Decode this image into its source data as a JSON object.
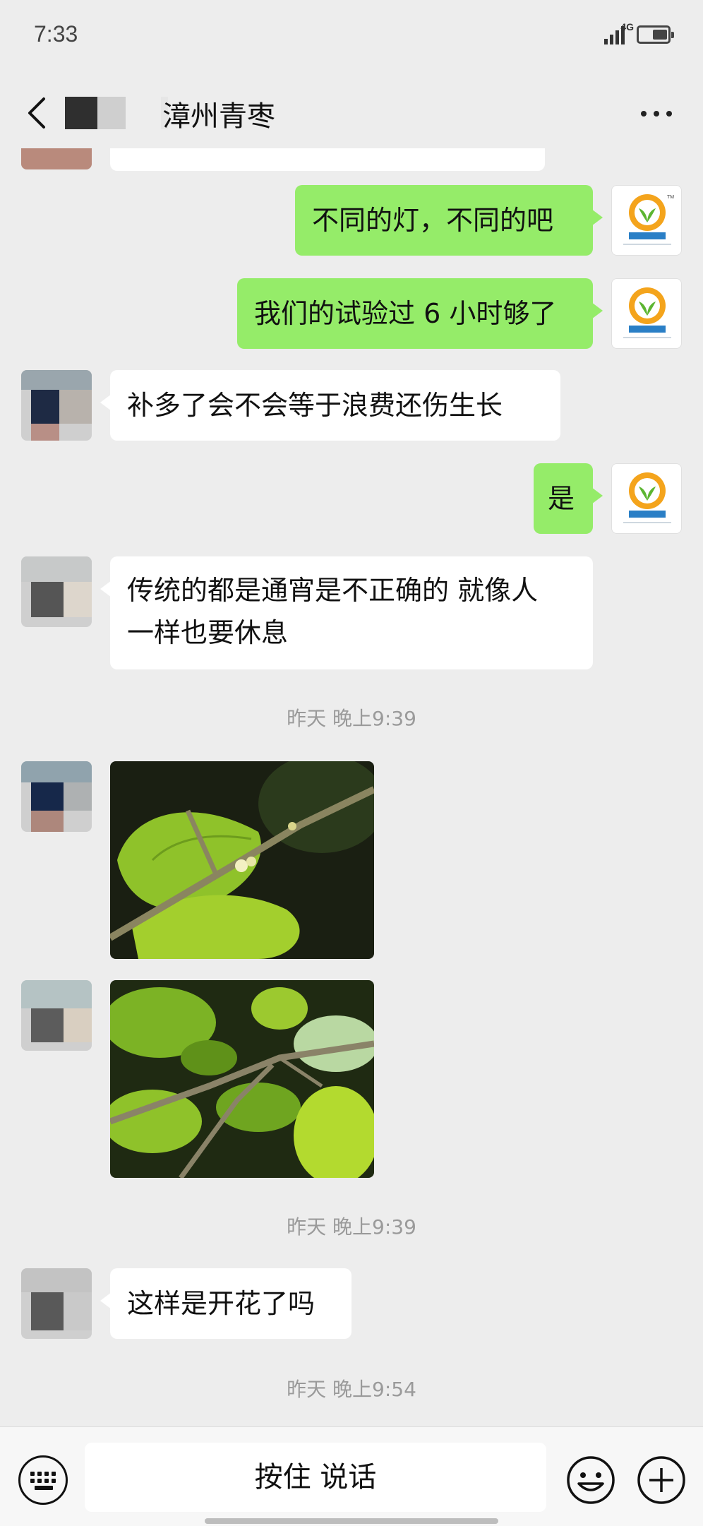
{
  "status_bar": {
    "time": "7:33",
    "network": "4G"
  },
  "header": {
    "title": "漳州青枣"
  },
  "messages": [
    {
      "side": "out",
      "text": "不同的灯，不同的吧"
    },
    {
      "side": "out",
      "text": "我们的试验过 6 小时够了"
    },
    {
      "side": "in",
      "text": "补多了会不会等于浪费还伤生长"
    },
    {
      "side": "out",
      "text": "是"
    },
    {
      "side": "in",
      "lines": [
        "传统的都是通宵是不正确的  就像人",
        "一样也要休息"
      ]
    }
  ],
  "timestamps": [
    "昨天 晚上9:39",
    "昨天 晚上9:39",
    "昨天 晚上9:54"
  ],
  "last_message": {
    "side": "in",
    "text": "这样是开花了吗"
  },
  "input": {
    "hold_to_talk": "按住 说话"
  },
  "icons": {
    "back": "chevron-left-icon",
    "more": "more-dots-icon",
    "keyboard": "keyboard-icon",
    "emoji": "emoji-icon",
    "plus": "plus-icon",
    "brand_avatar": "lightbulb-sprout-logo"
  },
  "colors": {
    "outgoing_bubble": "#95ec69",
    "incoming_bubble": "#ffffff",
    "background": "#ededed",
    "brand_orange": "#f4a41c",
    "brand_green": "#5cb531",
    "brand_blue": "#2a7fc6"
  }
}
